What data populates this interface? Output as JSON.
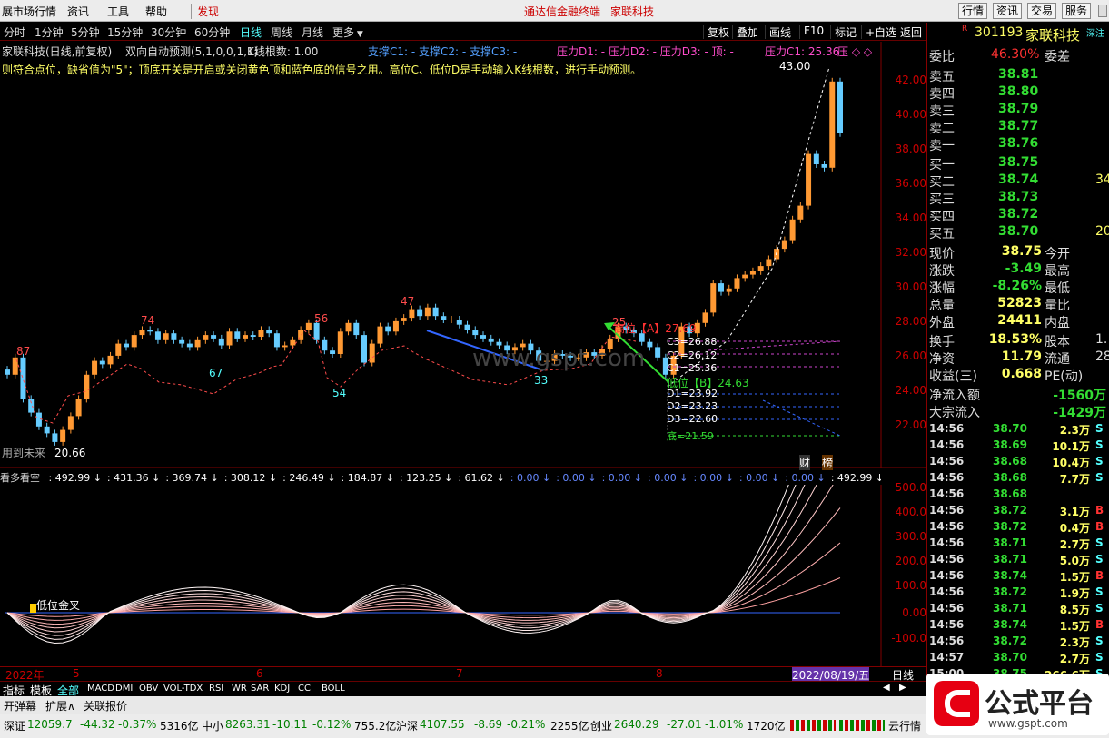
{
  "menubar": {
    "app_title": "展市场行情",
    "items": [
      "资讯",
      "工具",
      "帮助"
    ],
    "discover": "发现",
    "center_title": "通达信金融终端",
    "center_stock": "家联科技",
    "buttons": [
      "行情",
      "资讯",
      "交易",
      "服务"
    ]
  },
  "periods": [
    "分时",
    "1分钟",
    "5分钟",
    "15分钟",
    "30分钟",
    "60分钟",
    "日线",
    "周线",
    "月线",
    "更多"
  ],
  "toolbar_right": [
    "复权",
    "叠加",
    "画线",
    "F10",
    "标记",
    "+自选",
    "返回"
  ],
  "chart_title": {
    "name": "家联科技(日线,前复权)",
    "indicator": "双向自动预测(5,1,0,0,1,1)",
    "kline_count": "K线根数: 1.00",
    "support": "支撑C1: -  支撑C2: -  支撑C3: -",
    "pressure": "压力D1: -  压力D2: -  压力D3: -  顶: -",
    "pressure_c1": "压力C1: 25.36",
    "tail": "压 ◇ ◇"
  },
  "description": "则符合点位，缺省值为\"5\"；顶底开关是开启或关闭黄色顶和蓝色底的信号之用。高位C、低位D是手动输入K线根数，进行手动预测。",
  "main_axis": [
    "42.00",
    "40.00",
    "38.00",
    "36.00",
    "34.00",
    "32.00",
    "30.00",
    "28.00",
    "26.00",
    "24.00",
    "22.00"
  ],
  "sub_axis": [
    "500.0",
    "400.0",
    "300.0",
    "200.0",
    "100.0",
    "0.00",
    "-100.0"
  ],
  "annotations": {
    "high": "43.00",
    "p87": "87",
    "p74": "74",
    "p67": "67",
    "p56": "56",
    "p54": "54",
    "p47": "47",
    "p33": "33",
    "p25": "25",
    "low_label": "20.66",
    "used_future": "用到未来",
    "high_a": "高位【A】27.69",
    "low_b": "低位【B】24.63",
    "c3": "C3=26.88",
    "c2": "C2=26.12",
    "c1": "C1=25.36",
    "d1": "D1=23.92",
    "d2": "D2=23.23",
    "d3": "D3=22.60",
    "bottom": "底=21.59",
    "watermark": "www.gspt.com",
    "cai": "财",
    "bang": "榜"
  },
  "sub_title": {
    "name": "看多看空",
    "values": [
      "492.99",
      "431.36",
      "369.74",
      "308.12",
      "246.49",
      "184.87",
      "123.25",
      "61.62",
      "0.00",
      "0.00",
      "0.00",
      "0.00",
      "0.00",
      "0.00",
      "0.00",
      "492.99",
      "431.36",
      "369.74"
    ],
    "golden_cross": "低位金叉"
  },
  "date_axis": {
    "year": "2022年",
    "m5": "5",
    "m6": "6",
    "m7": "7",
    "m8": "8",
    "current_date": "2022/08/19/五",
    "period": "日线"
  },
  "indicator_tabs": [
    "指标",
    "模板",
    "全部",
    "MACD",
    "DMI",
    "OBV",
    "VOL-TDX",
    "RSI",
    "WR",
    "SAR",
    "KDJ",
    "CCI",
    "BOLL"
  ],
  "bottom_tabs": [
    "开弹幕",
    "扩展∧",
    "关联报价"
  ],
  "quote": {
    "code": "301193",
    "name": "家联科技",
    "weibi_label": "委比",
    "weibi": "46.30%",
    "weicha_label": "委差",
    "sells": [
      [
        "卖五",
        "38.81"
      ],
      [
        "卖四",
        "38.80"
      ],
      [
        "卖三",
        "38.79"
      ],
      [
        "卖二",
        "38.77"
      ],
      [
        "卖一",
        "38.76"
      ]
    ],
    "buys": [
      [
        "买一",
        "38.75"
      ],
      [
        "买二",
        "38.74"
      ],
      [
        "买三",
        "38.73"
      ],
      [
        "买四",
        "38.72"
      ],
      [
        "买五",
        "38.70"
      ]
    ],
    "buy_vols": [
      "",
      "34",
      "",
      "",
      "20"
    ],
    "stats": [
      [
        "现价",
        "38.75",
        "今开"
      ],
      [
        "涨跌",
        "-3.49",
        "最高"
      ],
      [
        "涨幅",
        "-8.26%",
        "最低"
      ],
      [
        "总量",
        "52823",
        "量比"
      ],
      [
        "外盘",
        "24411",
        "内盘"
      ]
    ],
    "stats2": [
      [
        "换手",
        "18.53%",
        "股本"
      ],
      [
        "净资",
        "11.79",
        "流通"
      ],
      [
        "收益(三)",
        "0.668",
        "PE(动)"
      ]
    ],
    "stats2_tail": [
      "1.",
      "28",
      ""
    ],
    "flow": [
      [
        "净流入额",
        "-1560万"
      ],
      [
        "大宗流入",
        "-1429万"
      ]
    ],
    "tag": "深注",
    "ticks": [
      [
        "14:56",
        "38.70",
        "2.3万",
        "S"
      ],
      [
        "14:56",
        "38.69",
        "10.1万",
        "S"
      ],
      [
        "14:56",
        "38.68",
        "10.4万",
        "S"
      ],
      [
        "14:56",
        "38.68",
        "7.7万",
        "S"
      ],
      [
        "14:56",
        "38.68",
        "",
        ""
      ],
      [
        "14:56",
        "38.72",
        "3.1万",
        "B"
      ],
      [
        "14:56",
        "38.72",
        "0.4万",
        "B"
      ],
      [
        "14:56",
        "38.71",
        "2.7万",
        "S"
      ],
      [
        "14:56",
        "38.71",
        "5.0万",
        "S"
      ],
      [
        "14:56",
        "38.74",
        "1.5万",
        "B"
      ],
      [
        "14:56",
        "38.72",
        "1.9万",
        "S"
      ],
      [
        "14:56",
        "38.71",
        "8.5万",
        "S"
      ],
      [
        "14:56",
        "38.74",
        "1.5万",
        "B"
      ],
      [
        "14:56",
        "38.72",
        "2.3万",
        "S"
      ],
      [
        "14:57",
        "38.70",
        "2.7万",
        "S"
      ],
      [
        "15:00",
        "38.75",
        "266.6万",
        "S"
      ]
    ]
  },
  "statusbar": {
    "sz": "深证",
    "sz_val": "12059.7",
    "sz_chg": "-44.32",
    "sz_pct": "-0.37%",
    "sz_amt": "5316亿",
    "zx": "中小",
    "zx_val": "8263.31",
    "zx_chg": "-10.11",
    "zx_pct": "-0.12%",
    "zx_amt": "755.2亿",
    "hs": "沪深",
    "hs_val": "4107.55",
    "hs_chg": "-8.69",
    "hs_pct": "-0.21%",
    "hs_amt": "2255亿",
    "cy": "创业",
    "cy_val": "2640.29",
    "cy_chg": "-27.01",
    "cy_pct": "-1.01%",
    "cy_amt": "1720亿",
    "yun": "云行情"
  },
  "logo": {
    "text": "公式平台",
    "url": "www.gspt.com"
  },
  "colors": {
    "up": "#ff3232",
    "down": "#54ffff",
    "bar_up": "#ff9933",
    "bar_down": "#66ccff",
    "axis": "#800000"
  }
}
